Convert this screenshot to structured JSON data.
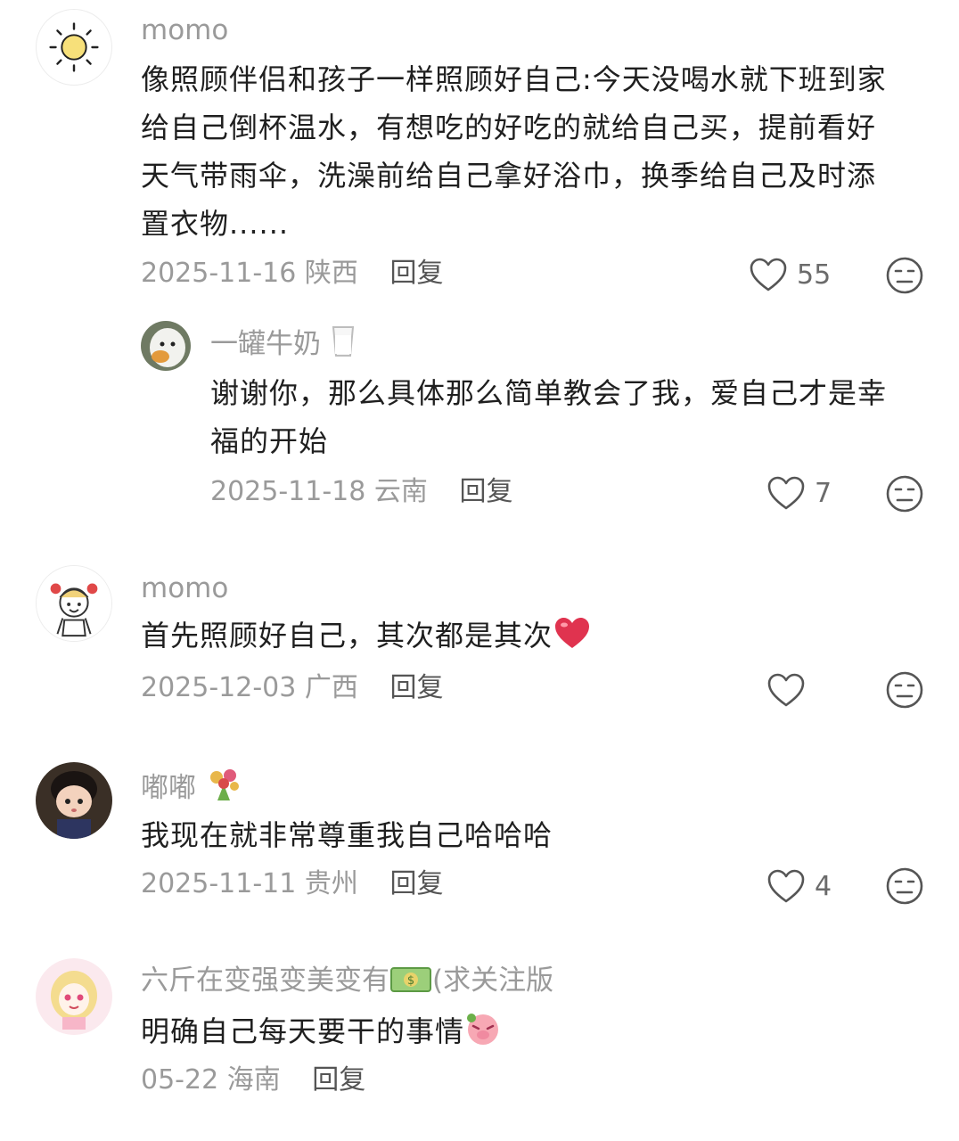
{
  "comments": [
    {
      "username": "momo",
      "text": "像照顾伴侣和孩子一样照顾好自己:今天没喝水就下班到家给自己倒杯温水，有想吃的好吃的就给自己买，提前看好天气带雨伞，洗澡前给自己拿好浴巾，换季给自己及时添置衣物......",
      "lines": [
        "像照顾伴侣和孩子一样照顾好自己:今天没喝水就下班到家",
        "给自己倒杯温水，有想吃的好吃的就给自己买，提前看好",
        "天气带雨伞，洗澡前给自己拿好浴巾，换季给自己及时添",
        "置衣物......"
      ],
      "date": "2025-11-16",
      "location": "陕西",
      "reply_label": "回复",
      "likes": "55",
      "avatar_icon": "sun-icon"
    },
    {
      "username": "一罐牛奶",
      "username_emoji": "milk-glass-icon",
      "lines": [
        "谢谢你，那么具体那么简单教会了我，爱自己才是幸",
        "福的开始"
      ],
      "date": "2025-11-18",
      "location": "云南",
      "reply_label": "回复",
      "likes": "7",
      "avatar_icon": "bird-avatar"
    },
    {
      "username": "momo",
      "text": "首先照顾好自己，其次都是其次",
      "text_emoji": "red-heart-icon",
      "date": "2025-12-03",
      "location": "广西",
      "reply_label": "回复",
      "likes": "",
      "avatar_icon": "cartoon-girl-avatar"
    },
    {
      "username": "嘟嘟",
      "username_emoji": "bouquet-icon",
      "text": "我现在就非常尊重我自己哈哈哈",
      "date": "2025-11-11",
      "location": "贵州",
      "reply_label": "回复",
      "likes": "4",
      "avatar_icon": "doll-avatar"
    },
    {
      "username": "六斤在变强变美变有",
      "username_emoji": "money-icon",
      "username_suffix": "(求关注版",
      "text": "明确自己每天要干的事情",
      "text_emoji": "crying-pig-icon",
      "date": "05-22",
      "location": "海南",
      "reply_label": "回复",
      "avatar_icon": "cartoon-blonde-avatar"
    }
  ],
  "colors": {
    "meta": "#9a9a9a",
    "text": "#1f1f1f",
    "heart_red": "#e0334f"
  }
}
